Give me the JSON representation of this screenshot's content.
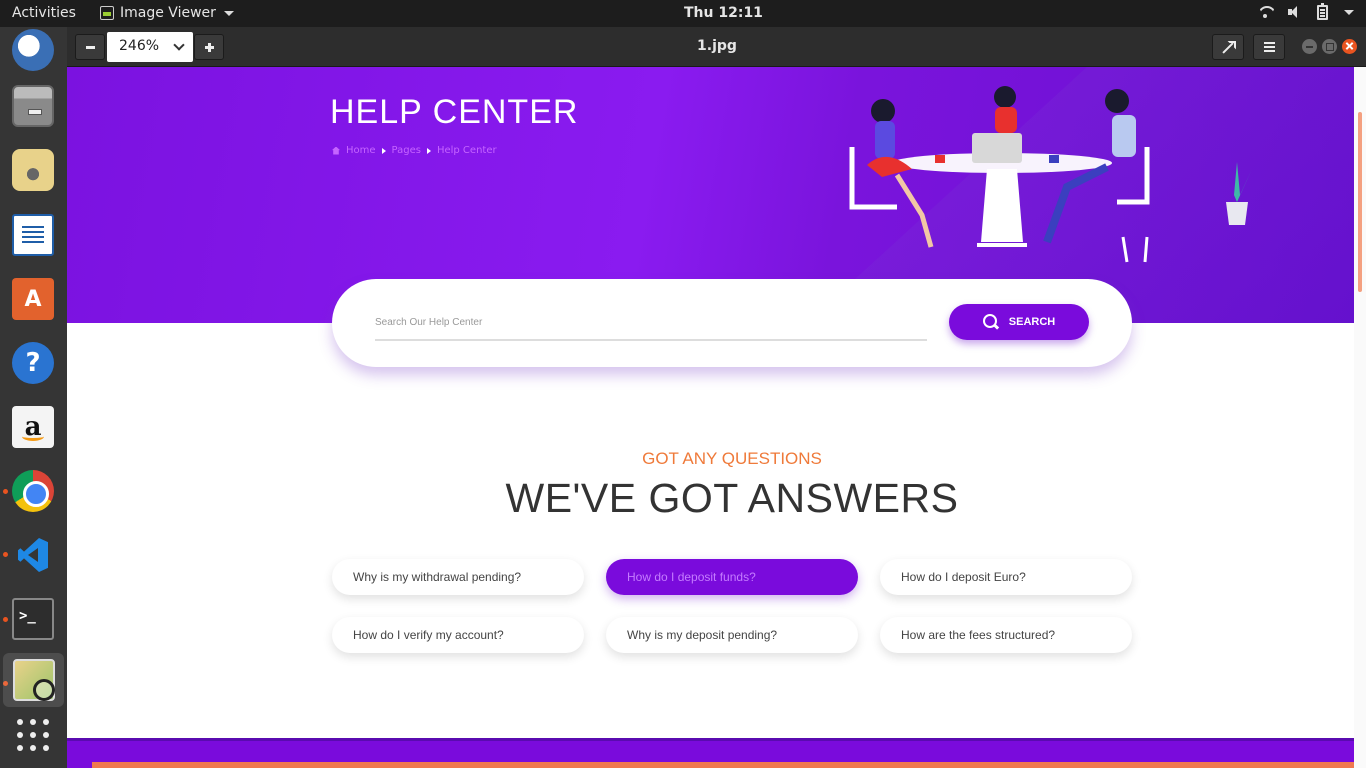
{
  "topbar": {
    "activities": "Activities",
    "app_name": "Image Viewer",
    "clock": "Thu 12:11"
  },
  "dock": {
    "items": [
      "thunderbird-icon",
      "files-icon",
      "rhythmbox-icon",
      "writer-icon",
      "software-icon",
      "help-icon",
      "amazon-icon",
      "chrome-icon",
      "vscode-icon",
      "terminal-icon",
      "image-viewer-icon",
      "show-apps-icon"
    ]
  },
  "viewer": {
    "zoom_level": "246%",
    "file_title": "1.jpg"
  },
  "page": {
    "hero_title": "HELP CENTER",
    "breadcrumb": [
      "Home",
      "Pages",
      "Help Center"
    ],
    "search_placeholder": "Search Our Help Center",
    "search_button": "SEARCH",
    "eyebrow": "GOT ANY QUESTIONS",
    "headline": "WE'VE GOT ANSWERS",
    "faqs": [
      "Why is my withdrawal pending?",
      "How do I deposit funds?",
      "How do I deposit Euro?",
      "How do I verify my account?",
      "Why is my deposit pending?",
      "How are the fees structured?"
    ],
    "active_faq_index": 1
  },
  "colors": {
    "brand_purple": "#7a0bdc",
    "accent_orange": "#ef7a3a",
    "ubuntu_orange": "#e95420"
  }
}
